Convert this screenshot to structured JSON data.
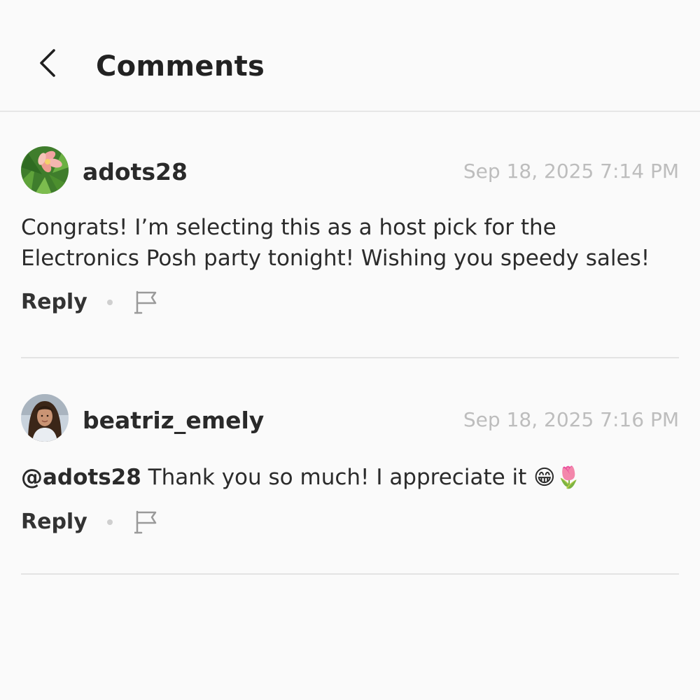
{
  "header": {
    "title": "Comments",
    "back_icon": "chevron-left-icon"
  },
  "comments": [
    {
      "username": "adots28",
      "timestamp": "Sep 18, 2025 7:14 PM",
      "text": "Congrats! I’m selecting this as a host pick for the Electronics Posh party tonight! Wishing you speedy sales!",
      "mention": "",
      "reply_label": "Reply",
      "avatar": "flower-avatar",
      "flag_icon": "flag-icon"
    },
    {
      "username": "beatriz_emely",
      "timestamp": "Sep 18, 2025 7:16 PM",
      "mention": "@adots28",
      "text": " Thank you so much! I appreciate it ",
      "emojis": "😁🌷",
      "reply_label": "Reply",
      "avatar": "person-avatar",
      "flag_icon": "flag-icon"
    }
  ],
  "colors": {
    "background": "#fafafa",
    "text": "#222222",
    "timestamp": "#bdbdbd",
    "divider": "#e3e3e3"
  }
}
